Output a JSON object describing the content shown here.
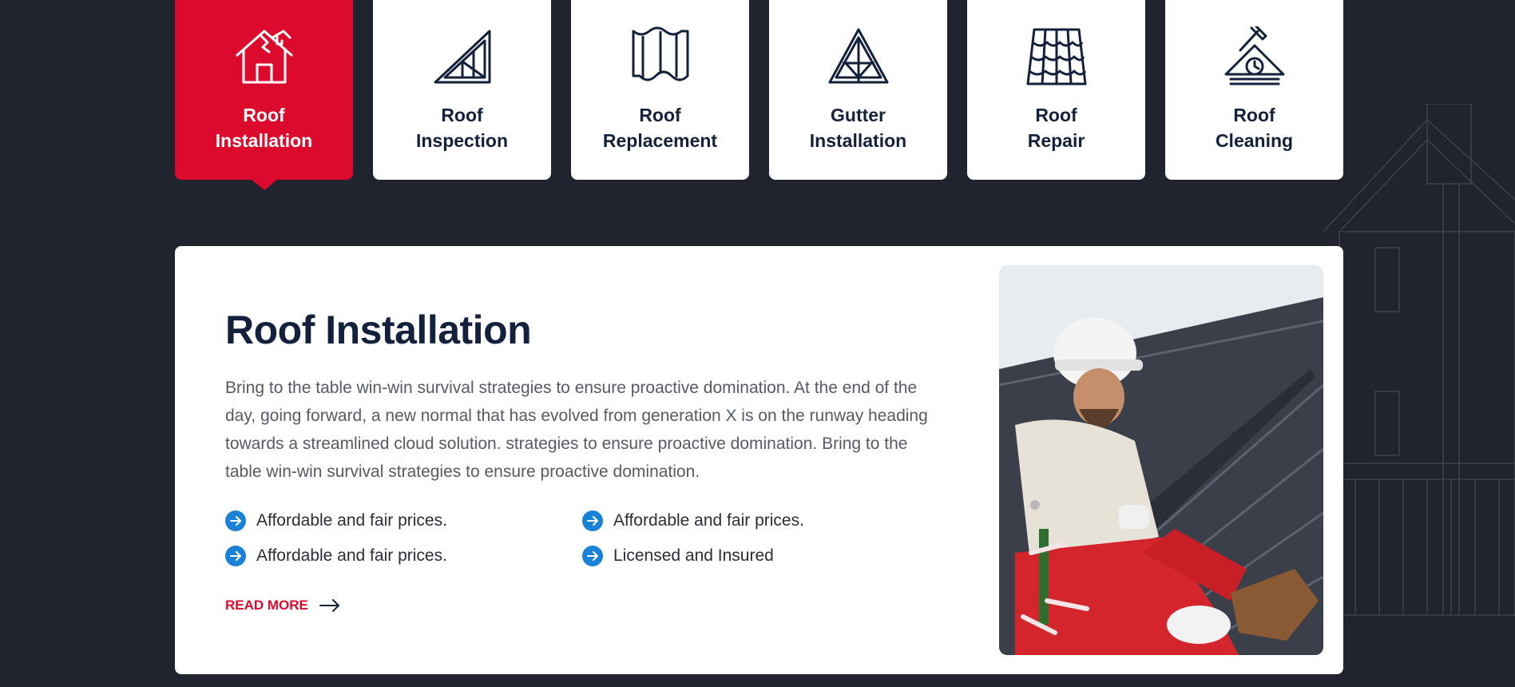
{
  "tabs": [
    {
      "label": "Roof\nInstallation",
      "icon": "house-broken-roof-icon",
      "active": true
    },
    {
      "label": "Roof\nInspection",
      "icon": "roof-truss-triangle-icon",
      "active": false
    },
    {
      "label": "Roof\nReplacement",
      "icon": "roof-sheet-icon",
      "active": false
    },
    {
      "label": "Gutter\nInstallation",
      "icon": "a-frame-truss-icon",
      "active": false
    },
    {
      "label": "Roof\nRepair",
      "icon": "roof-tiles-icon",
      "active": false
    },
    {
      "label": "Roof\nCleaning",
      "icon": "roof-hammer-clock-icon",
      "active": false
    }
  ],
  "panel": {
    "title": "Roof Installation",
    "description": "Bring to the table win-win survival strategies to ensure proactive domination. At the end of the day, going forward, a new normal that has evolved from generation X is on the runway heading towards a streamlined cloud solution. strategies to ensure proactive domination. Bring to the table win-win survival strategies to ensure proactive domination.",
    "features": [
      "Affordable and fair prices.",
      "Affordable and fair prices.",
      "Affordable and fair prices.",
      "Licensed and Insured"
    ],
    "read_more": "READ MORE",
    "image": "roofer-installing-metal-roof-photo"
  },
  "colors": {
    "background": "#21232f",
    "accent": "#dc0a2c",
    "heading": "#14213d",
    "check": "#1a82d6"
  }
}
